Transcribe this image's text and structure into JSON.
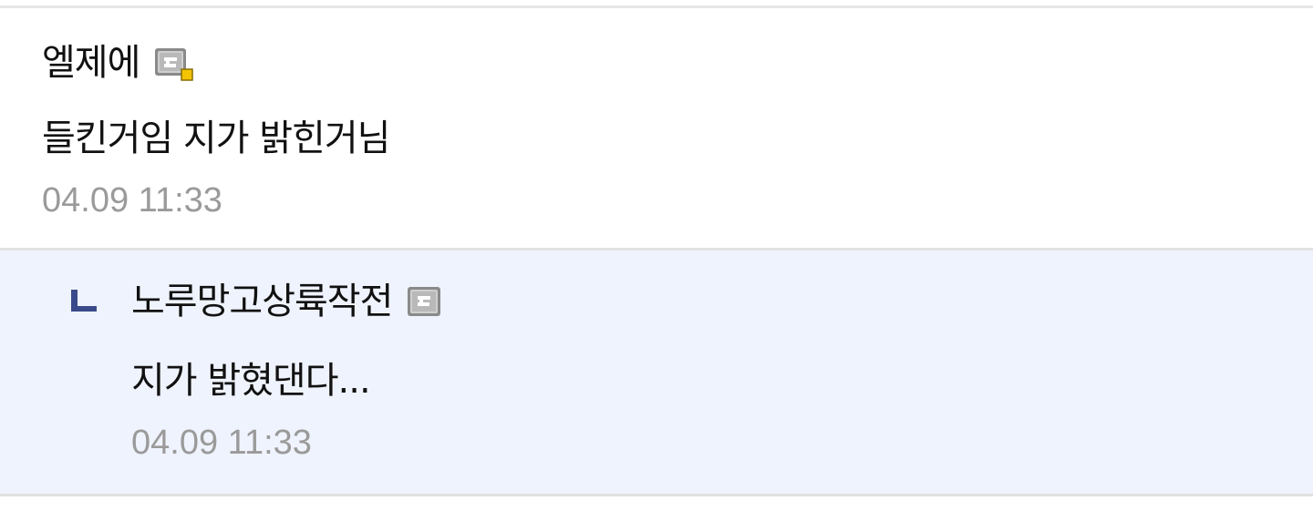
{
  "comments": [
    {
      "author": "엘제에",
      "author_icon": "gallery-member-icon",
      "body": "들킨거임 지가 밝힌거님",
      "timestamp": "04.09 11:33"
    }
  ],
  "replies": [
    {
      "reply_icon": "reply-arrow-icon",
      "author": "노루망고상륙작전",
      "author_icon": "gallery-member-icon",
      "body": "지가 밝혔댄다...",
      "timestamp": "04.09 11:33"
    }
  ],
  "colors": {
    "reply_background": "#eff3fd",
    "reply_arrow": "#3a4a8a",
    "timestamp": "#9a9a9a",
    "divider": "#e3e3e3"
  }
}
